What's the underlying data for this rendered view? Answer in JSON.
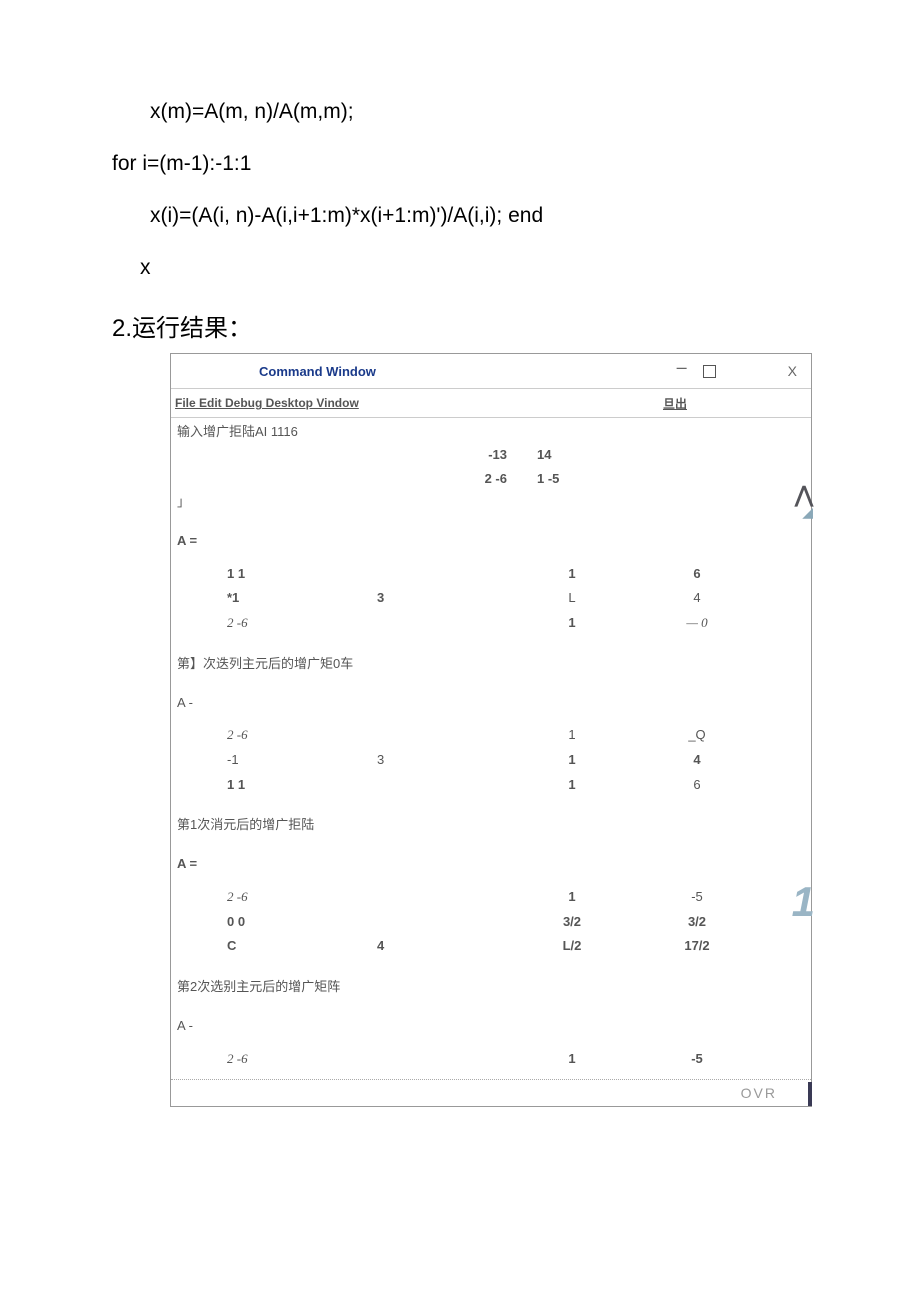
{
  "code": {
    "line1": "x(m)=A(m, n)/A(m,m);",
    "line2": "for i=(m-1):-1:1",
    "line3": "x(i)=(A(i, n)-A(i,i+1:m)*x(i+1:m)')/A(i,i); end",
    "line4": "x"
  },
  "section_title": "2.运行结果：",
  "window": {
    "title": "Command Window",
    "close_label": "X",
    "menubar": "File Edit Debug Desktop Vindow",
    "menubar_right": "旦出",
    "content": {
      "input_prompt": "输入增广拒陆AI 1116",
      "input_row1": {
        "a": "",
        "b": "-13",
        "c": "14",
        "d": ""
      },
      "input_row2": {
        "a": "",
        "b": "2 -6",
        "c": "1 -5",
        "d": ""
      },
      "bracket": "」",
      "A_eq": "A =",
      "A_minus": "A -",
      "m1_r1": {
        "a": "1 1",
        "b": "",
        "c": "1",
        "d": "6"
      },
      "m1_r2": {
        "a": "*1",
        "b": "3",
        "c": "L",
        "d": "4"
      },
      "m1_r3": {
        "a": "2 -6",
        "b": "",
        "c": "1",
        "d": "— 0"
      },
      "step1_label": "第】次迭列主元后的增广矩0车",
      "m2_r1": {
        "a": "2 -6",
        "b": "",
        "c": "1",
        "d": "_Q"
      },
      "m2_r2": {
        "a": "-1",
        "b": "3",
        "c": "1",
        "d": "4"
      },
      "m2_r3": {
        "a": "1 1",
        "b": "",
        "c": "1",
        "d": "6"
      },
      "step2_label": "第1次消元后的增广拒陆",
      "m3_r1": {
        "a": "2 -6",
        "b": "",
        "c": "1",
        "d": "-5"
      },
      "m3_r2": {
        "a": "0 0",
        "b": "",
        "c": "3/2",
        "d": "3/2"
      },
      "m3_r3": {
        "a": "C",
        "b": "4",
        "c": "L/2",
        "d": "17/2"
      },
      "step3_label": "第2次选别主元后的增广矩阵",
      "m4_r1": {
        "a": "2 -6",
        "b": "",
        "c": "1",
        "d": "-5"
      }
    },
    "status": "OVR"
  }
}
